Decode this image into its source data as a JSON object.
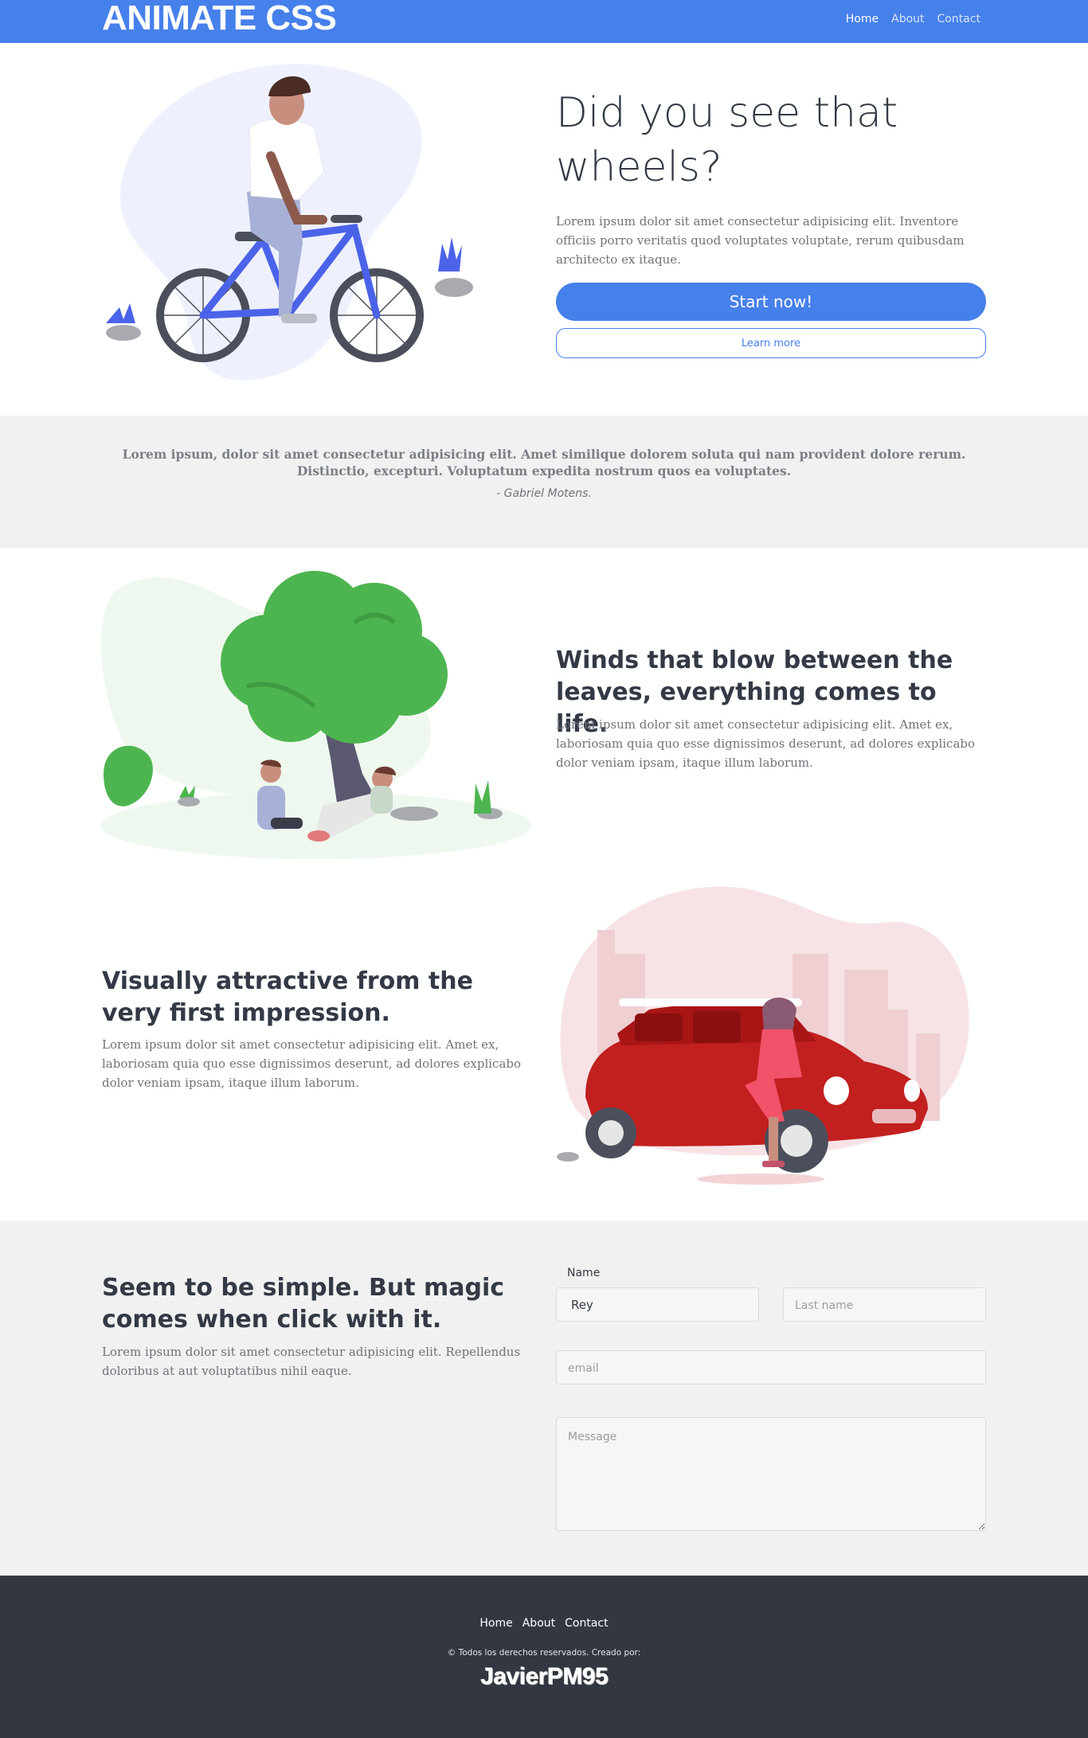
{
  "nav": {
    "brand": "ANIMATE CSS",
    "links": [
      {
        "label": "Home",
        "active": true
      },
      {
        "label": "About",
        "active": false
      },
      {
        "label": "Contact",
        "active": false
      }
    ]
  },
  "hero": {
    "title": "Did you see that wheels?",
    "text": "Lorem ipsum dolor sit amet consectetur adipisicing elit. Inventore officiis porro veritatis quod voluptates voluptate, rerum quibusdam architecto ex itaque.",
    "primary_button": "Start now!",
    "secondary_button": "Learn more",
    "illustration": "person-riding-bicycle"
  },
  "quote": {
    "text": "Lorem ipsum, dolor sit amet consectetur adipisicing elit. Amet similique dolorem soluta qui nam provident dolore rerum. Distinctio, excepturi. Voluptatum expedita nostrum quos ea voluptates.",
    "author": "- Gabriel Motens."
  },
  "feature1": {
    "title": "Winds that blow between the leaves, everything comes to life.",
    "text": "Lorem ipsum dolor sit amet consectetur adipisicing elit. Amet ex, laboriosam quia quo esse dignissimos deserunt, ad dolores explicabo dolor veniam ipsam, itaque illum laborum.",
    "illustration": "people-under-tree"
  },
  "feature2": {
    "title": "Visually attractive from the very first impression.",
    "text": "Lorem ipsum dolor sit amet consectetur adipisicing elit. Amet ex, laboriosam quia quo esse dignissimos deserunt, ad dolores explicabo dolor veniam ipsam, itaque illum laborum.",
    "illustration": "woman-leaning-on-red-car"
  },
  "contact": {
    "title": "Seem to be simple. But magic comes when click with it.",
    "text": "Lorem ipsum dolor sit amet consectetur adipisicing elit. Repellendus doloribus at aut voluptatibus nihil eaque.",
    "name_label": "Name",
    "first_name_value": "Rey",
    "last_name_placeholder": "Last name",
    "email_placeholder": "email",
    "message_placeholder": "Message"
  },
  "footer": {
    "links": [
      "Home",
      "About",
      "Contact"
    ],
    "copyright": "© Todos los derechos reservados. Creado por:",
    "signature": "JavierPM95"
  },
  "colors": {
    "primary": "#4680ea",
    "band": "#f1f1f1",
    "footer": "#333740",
    "heading": "#333a45",
    "body_text": "#6f737a"
  }
}
